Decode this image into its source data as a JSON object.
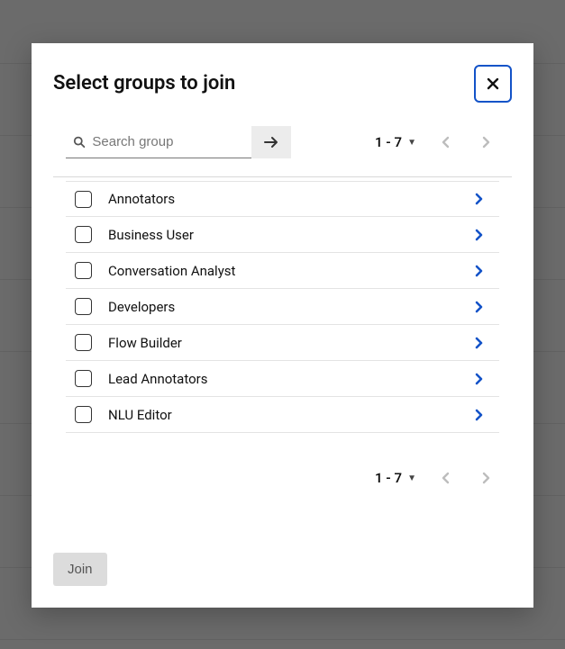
{
  "dialog": {
    "title": "Select groups to join"
  },
  "search": {
    "placeholder": "Search group",
    "value": ""
  },
  "pagination": {
    "range": "1 - 7"
  },
  "groups": [
    {
      "name": "Annotators"
    },
    {
      "name": "Business User"
    },
    {
      "name": "Conversation Analyst"
    },
    {
      "name": "Developers"
    },
    {
      "name": "Flow Builder"
    },
    {
      "name": "Lead Annotators"
    },
    {
      "name": "NLU Editor"
    }
  ],
  "footer": {
    "join_label": "Join"
  }
}
